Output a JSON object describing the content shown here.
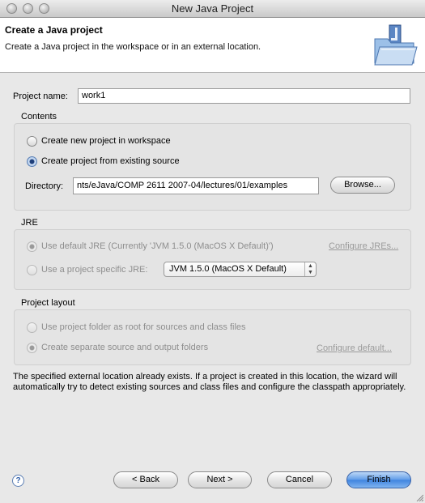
{
  "window": {
    "title": "New Java Project"
  },
  "banner": {
    "title": "Create a Java project",
    "description": "Create a Java project in the workspace or in an external location.",
    "icon": "java-project-folder-icon"
  },
  "project_name": {
    "label": "Project name:",
    "value": "work1"
  },
  "contents": {
    "title": "Contents",
    "option_new": "Create new project in workspace",
    "option_existing": "Create project from existing source",
    "selected": "option_existing",
    "directory_label": "Directory:",
    "directory_value": "nts/eJava/COMP 2611 2007-04/lectures/01/examples",
    "browse_label": "Browse..."
  },
  "jre": {
    "title": "JRE",
    "option_default": "Use default JRE (Currently 'JVM 1.5.0 (MacOS X Default)')",
    "configure_link": "Configure JREs...",
    "option_specific": "Use a project specific JRE:",
    "jre_select_value": "JVM 1.5.0 (MacOS X Default)"
  },
  "layout": {
    "title": "Project layout",
    "option_root": "Use project folder as root for sources and class files",
    "option_separate": "Create separate source and output folders",
    "configure_link": "Configure default..."
  },
  "info_text": "The specified external location already exists. If a project is created in this location, the wizard will automatically try to detect existing sources and class files and configure the classpath appropriately.",
  "buttons": {
    "help": "?",
    "back": "< Back",
    "next": "Next >",
    "cancel": "Cancel",
    "finish": "Finish"
  },
  "colors": {
    "default_button": "#3f83df",
    "banner_bg": "#ffffff",
    "dialog_bg": "#e8e8e8",
    "disabled_text": "#8e8e8e"
  }
}
